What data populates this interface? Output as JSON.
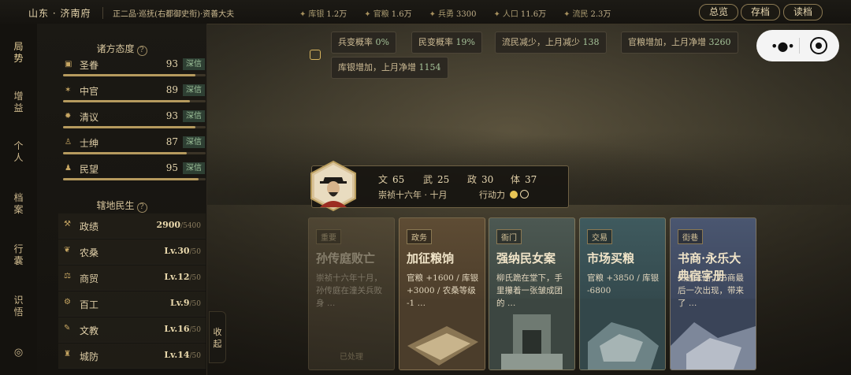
{
  "topbar": {
    "location": "山东 · 济南府",
    "rank": "正二品·巡抚(右都御史衔)·资善大夫",
    "stats": [
      {
        "label": "库银",
        "value": "1.2万",
        "icon": "silver-icon"
      },
      {
        "label": "官粮",
        "value": "1.6万",
        "icon": "grain-icon"
      },
      {
        "label": "兵勇",
        "value": "3300",
        "icon": "soldier-icon"
      },
      {
        "label": "人口",
        "value": "11.6万",
        "icon": "population-icon"
      },
      {
        "label": "流民",
        "value": "2.3万",
        "icon": "refugee-icon"
      }
    ],
    "buttons": [
      "总览",
      "存档",
      "读档"
    ]
  },
  "nav": [
    {
      "label": "局势",
      "active": true
    },
    {
      "label": "增益"
    },
    {
      "label": "个人"
    },
    {
      "label": "档案"
    },
    {
      "label": "行囊"
    },
    {
      "label": "识悟"
    }
  ],
  "attitudes": {
    "title": "诸方态度",
    "rows": [
      {
        "name": "圣眷",
        "value": "93",
        "tag": "深信",
        "pct": 93
      },
      {
        "name": "中官",
        "value": "89",
        "tag": "深信",
        "pct": 89
      },
      {
        "name": "清议",
        "value": "93",
        "tag": "深信",
        "pct": 93
      },
      {
        "name": "士绅",
        "value": "87",
        "tag": "深信",
        "pct": 87
      },
      {
        "name": "民望",
        "value": "95",
        "tag": "深信",
        "pct": 95
      }
    ]
  },
  "livelihood": {
    "title": "辖地民生",
    "rows": [
      {
        "name": "政绩",
        "value": "2900",
        "max": "/5400"
      },
      {
        "name": "农桑",
        "value": "Lv.30",
        "max": "/50"
      },
      {
        "name": "商贸",
        "value": "Lv.12",
        "max": "/50"
      },
      {
        "name": "百工",
        "value": "Lv.9",
        "max": "/50"
      },
      {
        "name": "文教",
        "value": "Lv.16",
        "max": "/50"
      },
      {
        "name": "城防",
        "value": "Lv.14",
        "max": "/50"
      }
    ]
  },
  "collapse_label": "收起",
  "news": [
    {
      "text": "兵变概率",
      "num": "0%"
    },
    {
      "text": "民变概率",
      "num": "19%"
    },
    {
      "text": "流民减少，上月减少",
      "num": "138"
    },
    {
      "text": "官粮增加，上月净增",
      "num": "3260"
    },
    {
      "text": "库银增加，上月净增",
      "num": "1154"
    }
  ],
  "character": {
    "stats": [
      {
        "label": "文",
        "value": "65"
      },
      {
        "label": "武",
        "value": "25"
      },
      {
        "label": "政",
        "value": "30"
      },
      {
        "label": "体",
        "value": "37"
      }
    ],
    "date": "崇祯十六年 · 十月",
    "action_label": "行动力",
    "action_points": 1,
    "action_max": 2
  },
  "cards": [
    {
      "badge": "重要",
      "title": "孙传庭败亡",
      "desc": "崇祯十六年十月，孙传庭在潼关兵败身 …",
      "status": "已处理"
    },
    {
      "badge": "政务",
      "title": "加征粮饷",
      "desc": "官粮 +1600 / 库银 +3000 / 农桑等级 -1 …"
    },
    {
      "badge": "衙门",
      "title": "强纳民女案",
      "desc": "柳氏跪在堂下，手里攥着一张皱成团的 …"
    },
    {
      "badge": "交易",
      "title": "市场买粮",
      "desc": "官粮 +3850 / 库银 -6800"
    },
    {
      "badge": "街巷",
      "title": "书商·永乐大典宿字册",
      "desc": "归途末路，书商最后一次出现，带来了 …"
    }
  ],
  "colors": {
    "accent": "#d8b45e",
    "positive": "#a7c49a",
    "tag_bg": "#2e3f33"
  }
}
